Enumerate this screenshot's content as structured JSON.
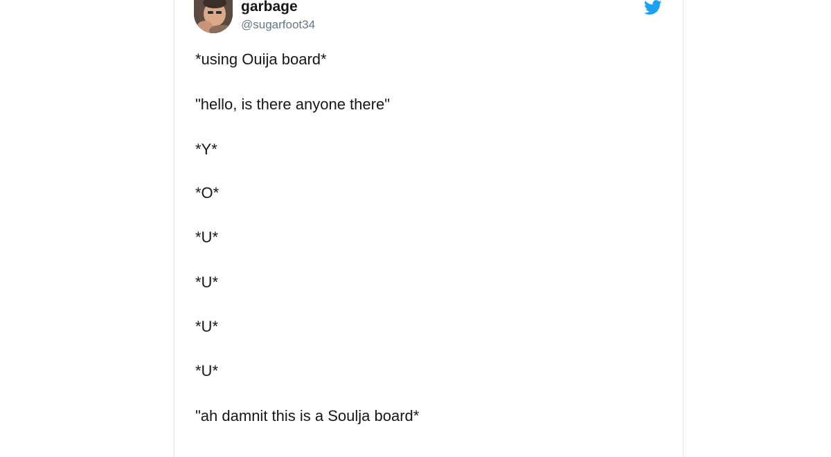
{
  "tweet": {
    "author": {
      "display_name": "garbage",
      "handle": "@sugarfoot34",
      "avatar_icon": "user-photo-avatar"
    },
    "brand_icon": "twitter-bird-icon",
    "brand_color": "#1da1f2",
    "lines": [
      "*using Ouija board*",
      "\"hello, is there anyone there\"",
      "*Y*",
      "*O*",
      "*U*",
      "*U*",
      "*U*",
      "*U*",
      "\"ah damnit this is a Soulja board*"
    ]
  }
}
